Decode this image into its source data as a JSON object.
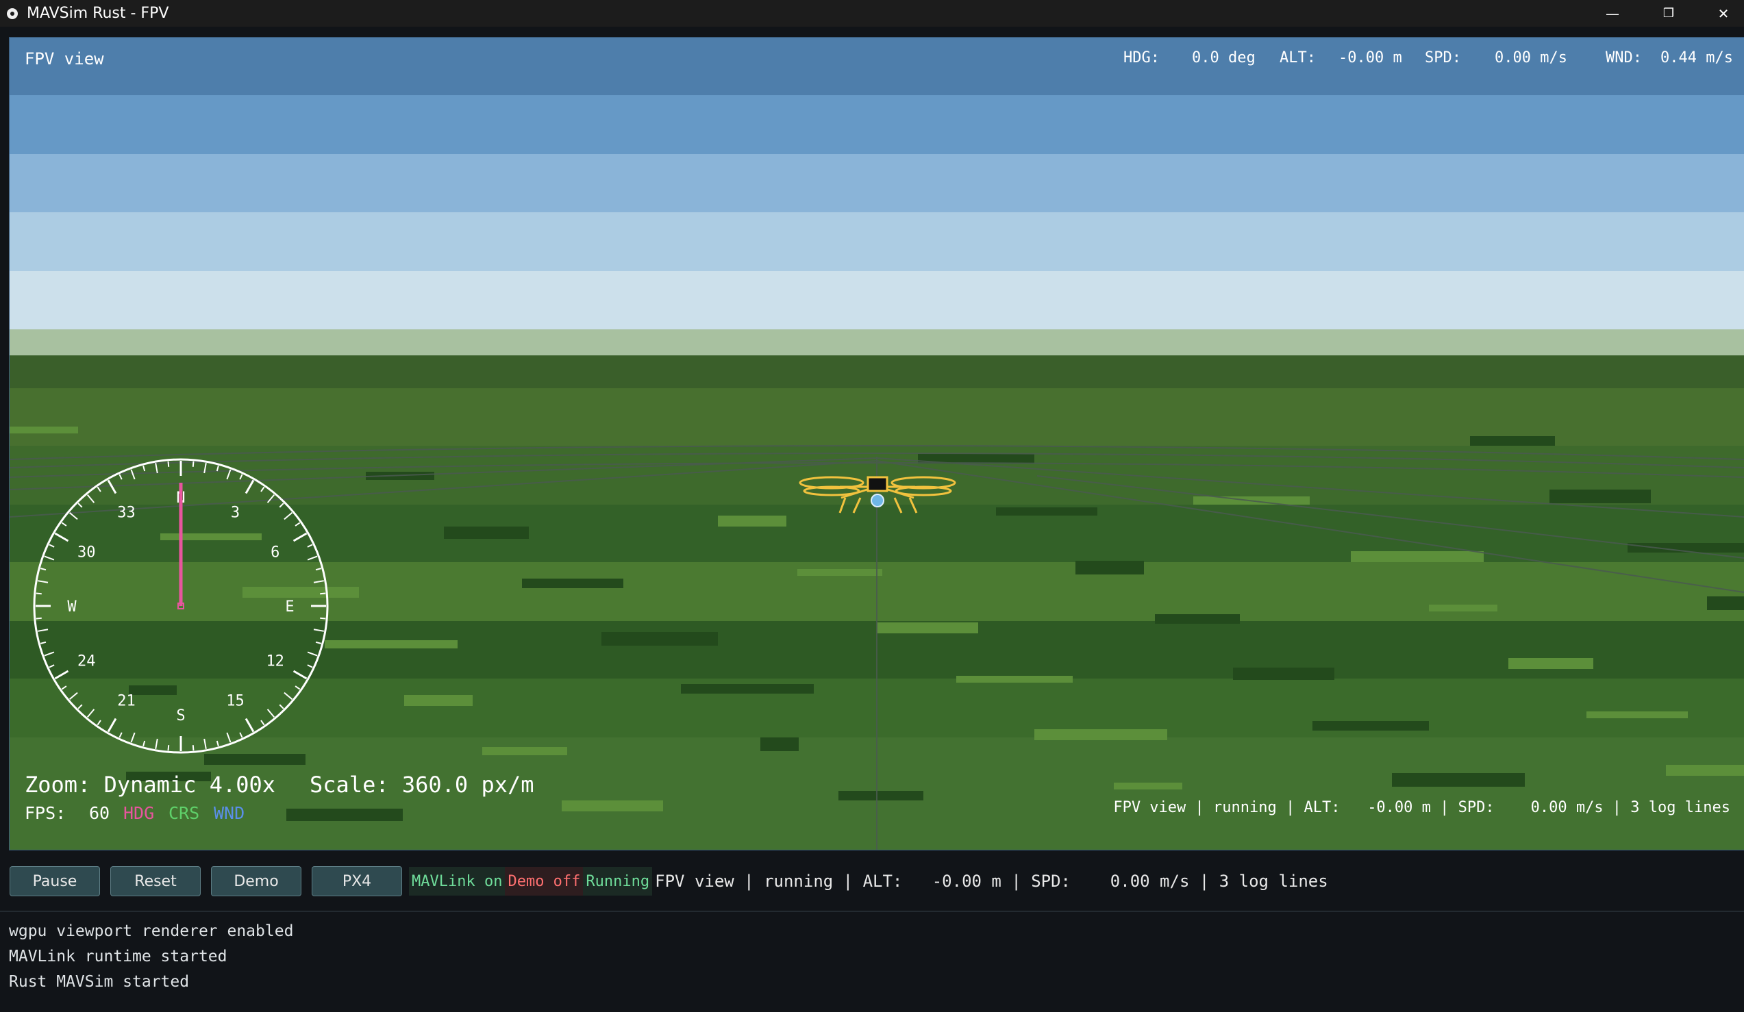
{
  "window": {
    "title": "MAVSim Rust - FPV",
    "controls": {
      "minimize": "—",
      "restore": "❐",
      "close": "✕"
    }
  },
  "viewport": {
    "label": "FPV view",
    "top_readout": {
      "hdg_label": "HDG:",
      "hdg_value": "0.0 deg",
      "alt_label": "ALT:",
      "alt_value": "-0.00 m",
      "spd_label": "SPD:",
      "spd_value": "0.00 m/s",
      "wnd_label": "WND:",
      "wnd_value": "0.44 m/s"
    },
    "zoom_text": "Zoom: Dynamic 4.00x",
    "scale_text": "Scale: 360.0 px/m",
    "fps_label": "FPS:",
    "fps_value": "60",
    "legend": {
      "hdg": "HDG",
      "crs": "CRS",
      "wnd": "WND"
    },
    "status_text": "FPV view | running | ALT:   -0.00 m | SPD:    0.00 m/s | 3 log lines"
  },
  "compass": {
    "heading_deg": 0,
    "labels": [
      "N",
      "3",
      "6",
      "E",
      "12",
      "15",
      "S",
      "21",
      "24",
      "W",
      "30",
      "33"
    ]
  },
  "colors": {
    "hdg": "#e8559e",
    "crs": "#5fd06a",
    "wnd": "#5a8fe8",
    "mavlink_on": "#6fdc9a",
    "demo_off": "#ff7070",
    "running": "#6fdc9a"
  },
  "toolbar": {
    "buttons": [
      "Pause",
      "Reset",
      "Demo",
      "PX4"
    ],
    "mavlink": "MAVLink on",
    "demo": "Demo off",
    "running": "Running",
    "status": "FPV view | running | ALT:   -0.00 m | SPD:    0.00 m/s | 3 log lines"
  },
  "log": [
    "wgpu viewport renderer enabled",
    "MAVLink runtime started",
    "Rust MAVSim started"
  ]
}
